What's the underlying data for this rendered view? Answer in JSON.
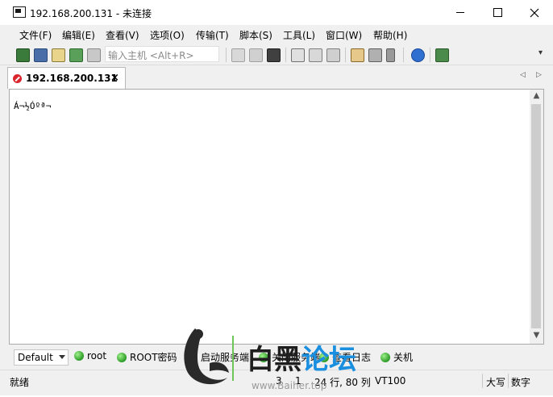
{
  "window": {
    "title": "192.168.200.131 - 未连接"
  },
  "menu": [
    "文件(F)",
    "编辑(E)",
    "查看(V)",
    "选项(O)",
    "传输(T)",
    "脚本(S)",
    "工具(L)",
    "窗口(W)",
    "帮助(H)"
  ],
  "toolbar": {
    "host_placeholder": "输入主机 <Alt+R>"
  },
  "tab": {
    "label": "192.168.200.131",
    "close": "×",
    "status_color": "#d9262c"
  },
  "terminal": {
    "text": "Á¬½Óºª¬"
  },
  "quickbar": {
    "session": "Default",
    "buttons": [
      "root",
      "ROOT密码",
      "启动服务端",
      "关闭服务端",
      "查看日志",
      "关机"
    ]
  },
  "status": {
    "ready": "就绪",
    "row": "3",
    "col": "1",
    "rows_cols": "24 行, 80 列",
    "term_type": "VT100",
    "caps": "大写",
    "num": "数字"
  },
  "watermark": {
    "brand": "白黑论坛",
    "url": "www.Baiher.top"
  }
}
